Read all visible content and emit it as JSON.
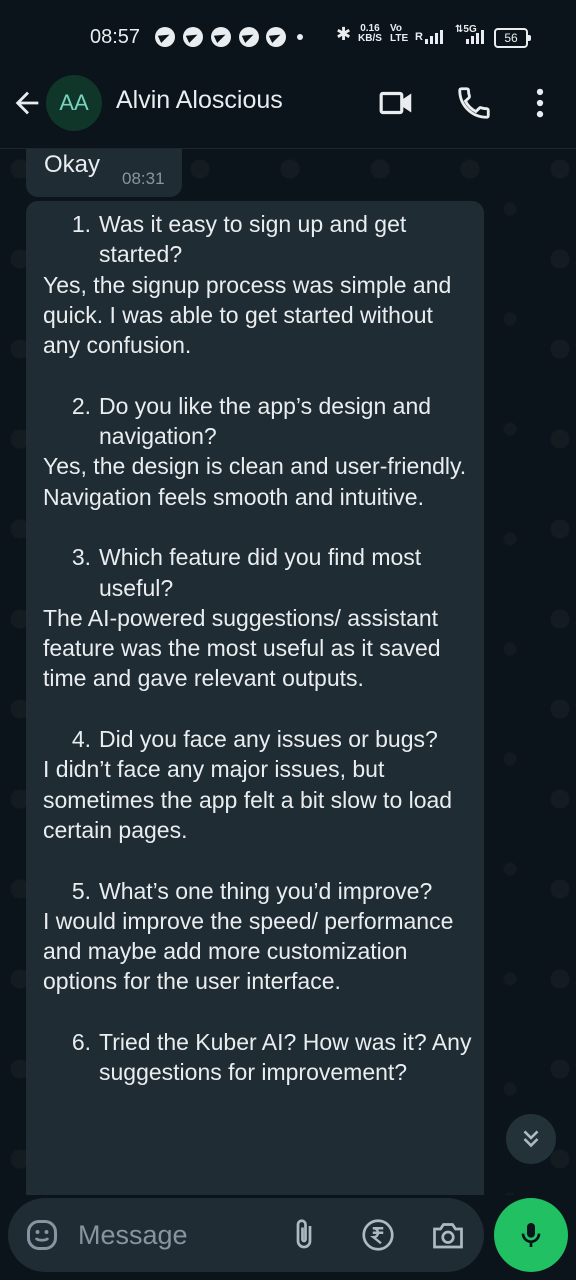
{
  "status_bar": {
    "time": "08:57",
    "net_speed_value": "0.16",
    "net_speed_unit": "KB/S",
    "volte_top": "Vo",
    "volte_bottom": "LTE",
    "sim_label": "R",
    "network_type": "5G",
    "battery": "56"
  },
  "header": {
    "avatar_initials": "AA",
    "contact_name": "Alvin Aloscious"
  },
  "messages": {
    "prev": {
      "text": "Okay",
      "time": "08:31"
    },
    "main": {
      "items": [
        {
          "num": "1.",
          "question": "Was it easy to sign up and get started?",
          "answer": "Yes, the signup process was simple and quick. I was able to get started without any confusion."
        },
        {
          "num": "2.",
          "question": "Do you like the app’s design and navigation?",
          "answer": "Yes, the design is clean and user-friendly. Navigation feels smooth and intuitive."
        },
        {
          "num": "3.",
          "question": "Which feature did you find most useful?",
          "answer": "The AI-powered suggestions/ assistant feature was the most useful as it saved time and gave relevant outputs."
        },
        {
          "num": "4.",
          "question": "Did you face any issues or bugs?",
          "answer": "I didn’t face any major issues, but sometimes the app felt a bit slow to load certain pages."
        },
        {
          "num": "5.",
          "question": "What’s one thing you’d improve?",
          "answer": "I would improve the speed/ performance and maybe add more customization options for the user interface."
        },
        {
          "num": "6.",
          "question": "Tried the Kuber AI? How was it? Any suggestions for improvement?",
          "answer": ""
        }
      ]
    }
  },
  "input": {
    "placeholder": "Message"
  },
  "colors": {
    "background": "#0b141a",
    "bubble": "#202c33",
    "accent_green": "#21c063",
    "secondary_text": "#8696a0"
  },
  "icons": {
    "back": "back-arrow-icon",
    "video": "video-call-icon",
    "voice": "voice-call-icon",
    "menu": "more-options-icon",
    "emoji": "emoji-icon",
    "attach": "attachment-icon",
    "payment": "rupee-payment-icon",
    "camera": "camera-icon",
    "mic": "mic-icon",
    "scroll": "scroll-down-icon"
  }
}
